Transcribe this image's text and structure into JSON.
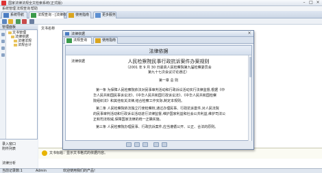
{
  "window": {
    "title": "国家法律法规全文检索系统(正式版)"
  },
  "menu": [
    "系统管理",
    "法规查询",
    "帮助"
  ],
  "tabs": [
    {
      "label": "系统导航"
    },
    {
      "label": "法规查询 - [法律依据]"
    },
    {
      "label": "使用指南"
    },
    {
      "label": "更多服务"
    }
  ],
  "left": {
    "header": "管理面板",
    "tree": [
      "文书管理",
      "法律依据",
      "法律法规",
      "法规合计"
    ],
    "bottom": [
      "录入窗口",
      "附件列表",
      "法律分析"
    ]
  },
  "list": {
    "header": "文书名称"
  },
  "dialog": {
    "title": "法律依据",
    "tabs": [
      "法规查询",
      "使用指南"
    ],
    "header": "法律依据",
    "label": "法律依据",
    "law_title": "人民检察院民事行政抗诉案件办案规则",
    "law_meta1": "（2001 年 9 月 30 日最高人民检察院第九届检察委员会",
    "law_meta2": "第九十七次会议讨论通过）",
    "chapter": "第一章 总 则",
    "p1": "第一条 为保障人民检察院依法对民事审判活动和行政诉讼活动实行法律监督,根据《中",
    "p2": "华人民共和国民事诉讼法》、《中华人民共和国行政诉讼法》、《中华人民共和国检察",
    "p3": "院组织法》和其他有关法律,结合检察工作实际,制定本规则。",
    "p4": "第二条 人民检察院依法独立行使检察权,通过办理民事、行政抗诉案件,对人民法院",
    "p5": "的民事审判活动和行政诉讼活动进行法律监督,维护国家利益和社会公共利益,维护司法公",
    "p6": "正和司法权威,保障国家法律的统一正确实施。",
    "p7": "第三条 人民检察院办理民事、行政抗诉案件,应当遵循公开、公正、合法的原则。"
  },
  "hint": "文书标题：显示文书格式的依据内容。",
  "status": {
    "left": "当前记录数:1",
    "user": "Admin",
    "right": "欢迎使用我们的产品!"
  }
}
